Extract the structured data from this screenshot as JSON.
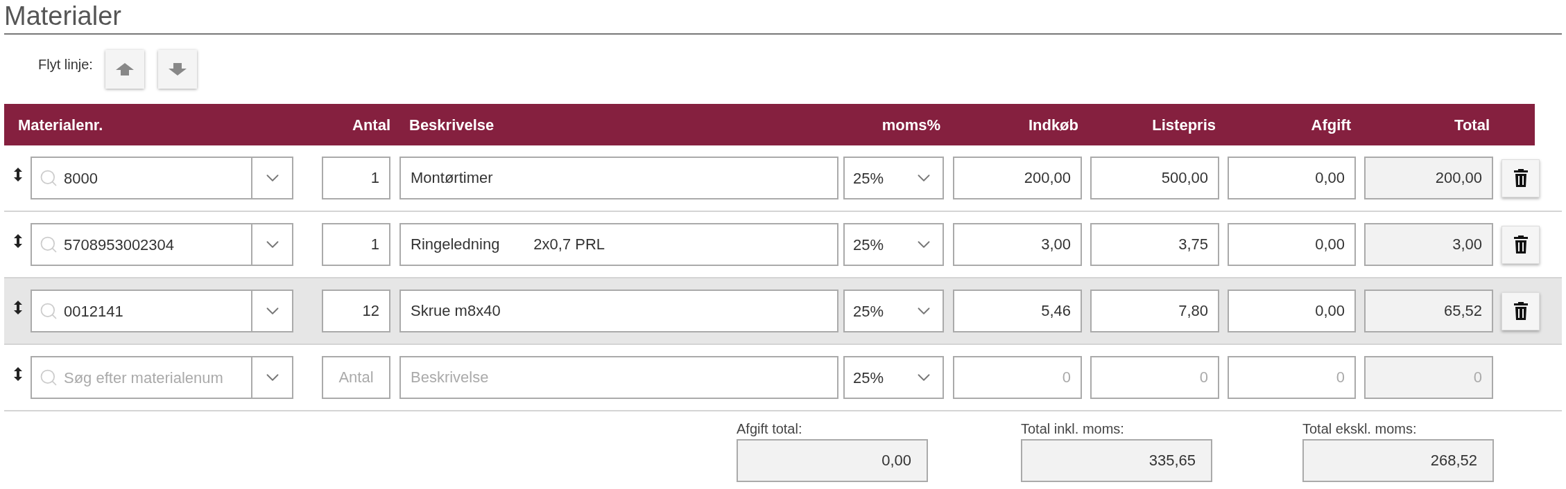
{
  "title": "Materialer",
  "move_line": {
    "label": "Flyt linje:"
  },
  "columns": [
    "Materialenr.",
    "Antal",
    "Beskrivelse",
    "moms%",
    "Indkøb",
    "Listepris",
    "Afgift",
    "Total"
  ],
  "rows": [
    {
      "material_no": "8000",
      "quantity": "1",
      "description": "Montørtimer",
      "vat": "25%",
      "purchase": "200,00",
      "list_price": "500,00",
      "fee": "0,00",
      "total": "200,00",
      "selected": false
    },
    {
      "material_no": "5708953002304",
      "quantity": "1",
      "description": "Ringeledning        2x0,7 PRL",
      "vat": "25%",
      "purchase": "3,00",
      "list_price": "3,75",
      "fee": "0,00",
      "total": "3,00",
      "selected": false
    },
    {
      "material_no": "0012141",
      "quantity": "12",
      "description": "Skrue m8x40",
      "vat": "25%",
      "purchase": "5,46",
      "list_price": "7,80",
      "fee": "0,00",
      "total": "65,52",
      "selected": true
    }
  ],
  "new_row": {
    "material_placeholder": "Søg efter materialenum",
    "quantity_placeholder": "Antal",
    "description_placeholder": "Beskrivelse",
    "vat": "25%",
    "purchase_placeholder": "0",
    "list_price_placeholder": "0",
    "fee_placeholder": "0",
    "total_placeholder": "0"
  },
  "totals": [
    {
      "label": "Afgift total:",
      "value": "0,00"
    },
    {
      "label": "Total inkl. moms:",
      "value": "335,65"
    },
    {
      "label": "Total ekskl. moms:",
      "value": "268,52"
    }
  ]
}
